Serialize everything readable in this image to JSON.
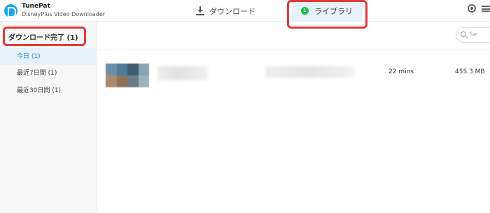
{
  "app": {
    "name": "TunePat",
    "subtitle": "DisneyPlus Video Downloader"
  },
  "tabs": {
    "download_label": "ダウンロード",
    "library_label": "ライブラリ"
  },
  "sidebar": {
    "title": "ダウンロード完了 (1)",
    "items": [
      {
        "label": "今日 (1)",
        "active": true
      },
      {
        "label": "最近7日間 (1)",
        "active": false
      },
      {
        "label": "最近30日間 (1)",
        "active": false
      }
    ]
  },
  "search": {
    "placeholder": "Se"
  },
  "videos": [
    {
      "duration": "22 mins",
      "size": "455.3 MB"
    }
  ],
  "colors": {
    "accent": "#1a8ad6",
    "highlight_box": "#e53935",
    "library_icon": "#1fbf4e"
  }
}
